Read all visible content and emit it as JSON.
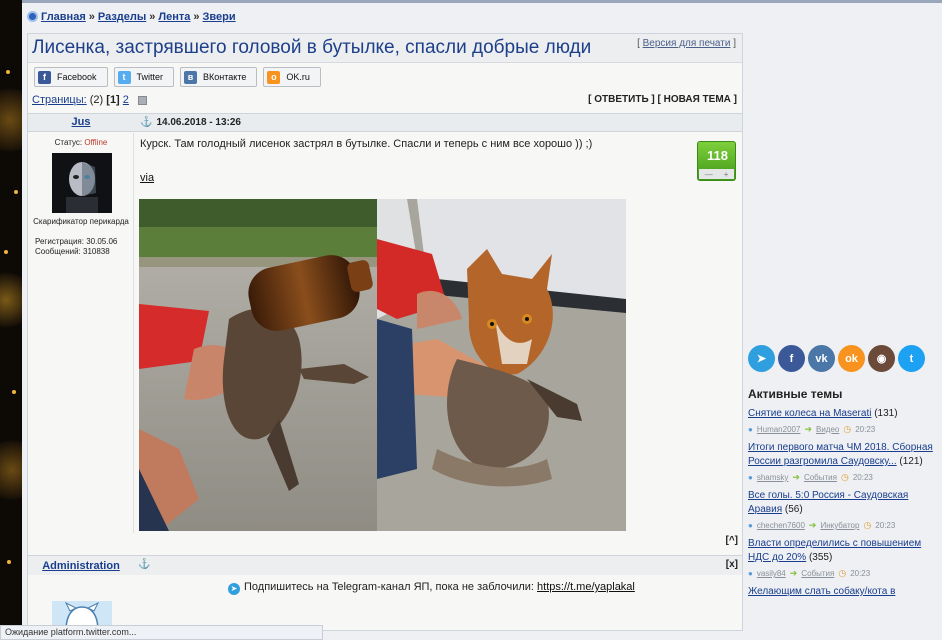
{
  "breadcrumb": {
    "home": "Главная",
    "sections": "Разделы",
    "feed": "Лента",
    "category": "Звери",
    "sep": "»"
  },
  "post": {
    "title": "Лисенка, застрявшего головой в бутылке, спасли добрые люди",
    "print_link": "Версия для печати",
    "share": [
      {
        "label": "Facebook",
        "icon": "facebook-icon",
        "color": "#3b5998",
        "glyph": "f"
      },
      {
        "label": "Twitter",
        "icon": "twitter-icon",
        "color": "#55acee",
        "glyph": "t"
      },
      {
        "label": "ВКонтакте",
        "icon": "vk-icon",
        "color": "#4a76a8",
        "glyph": "в"
      },
      {
        "label": "OK.ru",
        "icon": "ok-icon",
        "color": "#f7931e",
        "glyph": "о"
      }
    ],
    "pages_label": "Страницы:",
    "pages_count": "(2)",
    "current_page": "[1]",
    "next_page": "2",
    "reply_links": "[ ОТВЕТИТЬ ] [ НОВАЯ ТЕМА ]",
    "author": "Jus",
    "date": "14.06.2018 - 13:26",
    "status_label": "Статус:",
    "status_value": "Offline",
    "rank": "Скарификатор перикарда",
    "reg": "Регистрация: 30.05.06",
    "messages": "Сообщений: 310838",
    "text": "Курск. Там голодный лисенок застрял в бутылке. Спасли и теперь с ним все хорошо )) ;)",
    "via": "via",
    "rating": "118",
    "rating_minus": "—",
    "rating_plus": "+",
    "up_btn": "[^]"
  },
  "post2": {
    "author": "Administration",
    "close_btn": "[x]",
    "telegram_text": "Подпишитесь на Telegram-канал ЯП, пока не заблочили:",
    "telegram_link": "https://t.me/yaplakal"
  },
  "sidebar": {
    "social": [
      {
        "name": "telegram-icon",
        "color": "#2f9fe0",
        "glyph": "➤"
      },
      {
        "name": "facebook-icon",
        "color": "#3b5998",
        "glyph": "f"
      },
      {
        "name": "vk-icon",
        "color": "#4a76a8",
        "glyph": "vk"
      },
      {
        "name": "ok-icon",
        "color": "#f7931e",
        "glyph": "ok"
      },
      {
        "name": "instagram-icon",
        "color": "#6b4a3a",
        "glyph": "◉"
      },
      {
        "name": "twitter-icon",
        "color": "#1da1f2",
        "glyph": "t"
      }
    ],
    "active_title": "Активные темы",
    "topics": [
      {
        "title": "Снятие колеса на Maserati",
        "count": "(131)",
        "user": "Human2007",
        "section": "Видео",
        "time": "20:23"
      },
      {
        "title": "Итоги первого матча ЧМ 2018. Сборная России разгромила Саудовску...",
        "count": "(121)",
        "user": "shamsky",
        "section": "События",
        "time": "20:23"
      },
      {
        "title": "Все голы. 5:0 Россия - Саудовская Аравия",
        "count": "(56)",
        "user": "chechen7600",
        "section": "Инкубатор",
        "time": "20:23"
      },
      {
        "title": "Власти определились с повышением НДС до 20%",
        "count": "(355)",
        "user": "vasily84",
        "section": "События",
        "time": "20:23"
      },
      {
        "title": "Желающим слать собаку/кота в",
        "count": "",
        "user": "",
        "section": "",
        "time": ""
      }
    ]
  },
  "statusbar": "Ожидание platform.twitter.com..."
}
